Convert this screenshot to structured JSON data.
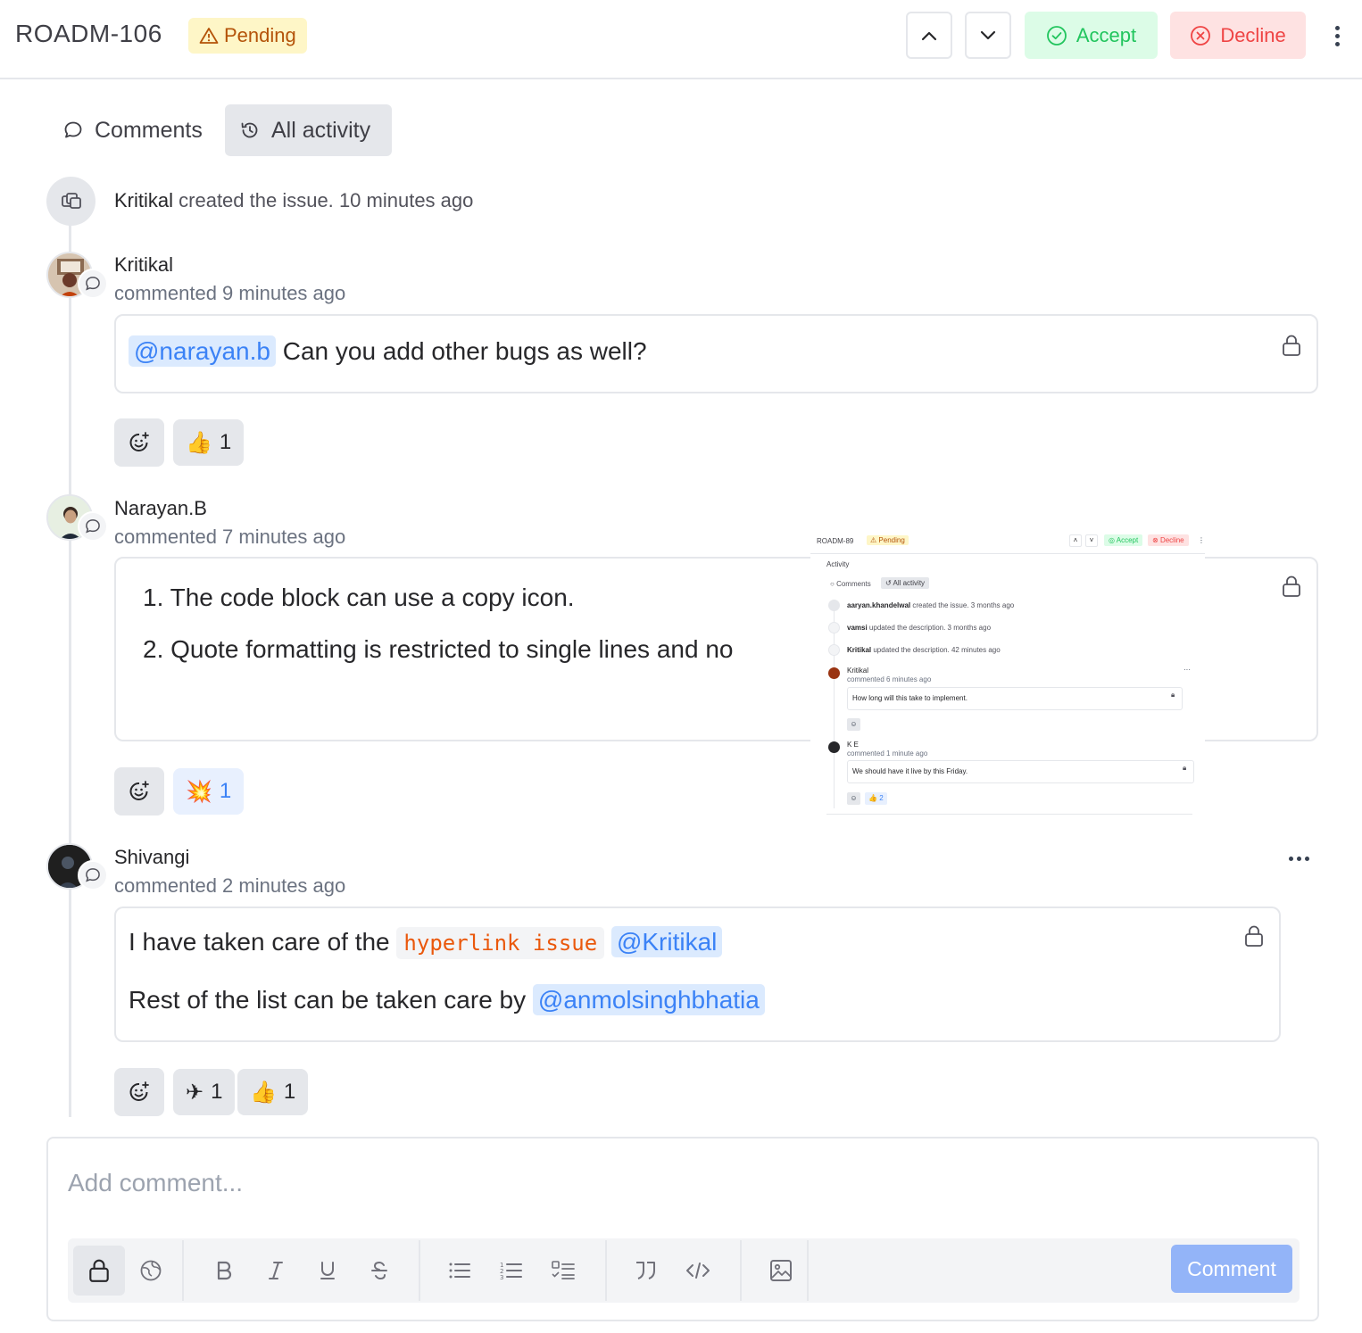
{
  "header": {
    "issue_id": "ROADM-106",
    "status": "Pending",
    "accept_label": "Accept",
    "decline_label": "Decline"
  },
  "tabs": [
    {
      "label": "Comments",
      "icon": "chat-bubble-icon",
      "active": false
    },
    {
      "label": "All activity",
      "icon": "history-icon",
      "active": true
    }
  ],
  "activity": {
    "created": {
      "user": "Kritikal",
      "text": "created the issue.",
      "time": "10 minutes ago"
    }
  },
  "comments": [
    {
      "author": "Kritikal",
      "meta": "commented 9 minutes ago",
      "mention": "@narayan.b",
      "text": "Can you add other bugs as well?",
      "reactions": [
        {
          "emoji": "👍",
          "count": "1",
          "active": false
        }
      ]
    },
    {
      "author": "Narayan.B",
      "meta": "commented 7 minutes ago",
      "list": [
        "1. The code block can use a copy icon.",
        "2. Quote formatting is restricted to single lines and no"
      ],
      "reactions": [
        {
          "emoji": "💥",
          "count": "1",
          "active": true
        }
      ]
    },
    {
      "author": "Shivangi",
      "meta": "commented 2 minutes ago",
      "line1_text": "I have taken care of the",
      "line1_code": "hyperlink issue",
      "line1_mention": "@Kritikal",
      "line2_text": "Rest of the list can be taken care by",
      "line2_mention": "@anmolsinghbhatia",
      "reactions": [
        {
          "emoji": "✈",
          "count": "1",
          "active": false
        },
        {
          "emoji": "👍",
          "count": "1",
          "active": false
        }
      ]
    }
  ],
  "embedded_screenshot": {
    "issue_id": "ROADM-89",
    "status": "Pending",
    "accept_label": "Accept",
    "decline_label": "Decline",
    "section_title": "Activity",
    "tab_comments": "Comments",
    "tab_all": "All activity",
    "entries": [
      {
        "user": "aaryan.khandelwal",
        "text": "created the issue. 3 months ago"
      },
      {
        "user": "vamsi",
        "text": "updated the description. 3 months ago"
      },
      {
        "user": "Kritikal",
        "text": "updated the description. 42 minutes ago"
      }
    ],
    "comment1": {
      "author": "Kritikal",
      "meta": "commented 6 minutes ago",
      "text": "How long will this take to implement."
    },
    "comment2": {
      "author": "K E",
      "meta": "commented 1 minute ago",
      "text": "We should have it live by this Friday.",
      "reaction": "2"
    }
  },
  "composer": {
    "placeholder": "Add comment...",
    "submit_label": "Comment",
    "tools": [
      "lock-icon",
      "globe-icon",
      "bold-icon",
      "italic-icon",
      "underline-icon",
      "strikethrough-icon",
      "bullet-list-icon",
      "numbered-list-icon",
      "checklist-icon",
      "quote-icon",
      "code-icon",
      "image-icon"
    ]
  },
  "colors": {
    "pending_bg": "#fef6c7",
    "pending_text": "#b45309",
    "accept_bg": "#dcfce7",
    "accept_text": "#22c55e",
    "decline_bg": "#fee2e2",
    "decline_text": "#ef4444",
    "mention_bg": "#dbeafe",
    "mention_text": "#3b82f6",
    "code_text": "#ea580c",
    "comment_button": "#93b4f8"
  }
}
